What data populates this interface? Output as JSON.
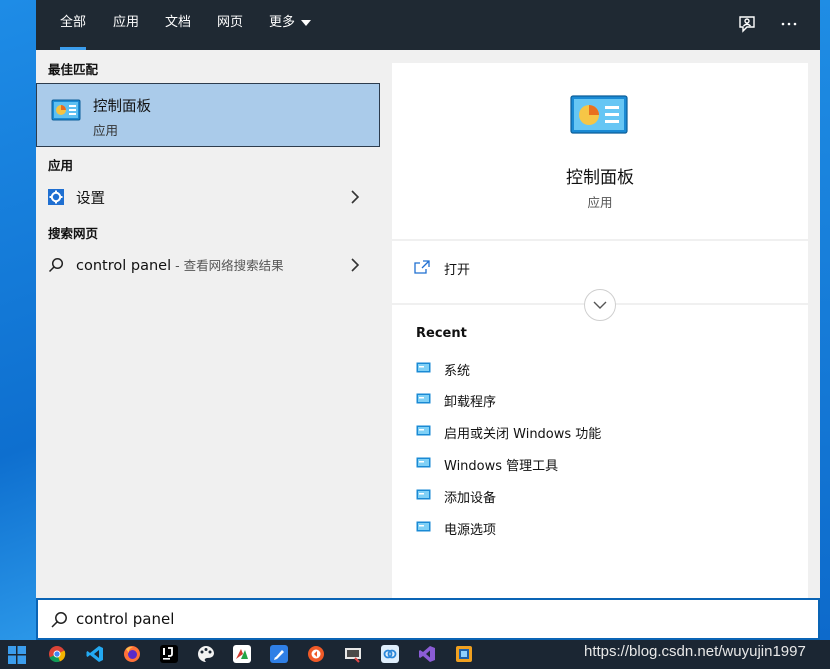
{
  "tabs": [
    {
      "label": "全部",
      "active": true
    },
    {
      "label": "应用"
    },
    {
      "label": "文档"
    },
    {
      "label": "网页"
    },
    {
      "label": "更多"
    }
  ],
  "topbar_icons": [
    "feedback-icon",
    "more-options-icon"
  ],
  "left": {
    "best_match_title": "最佳匹配",
    "best_match": {
      "title": "控制面板",
      "subtitle": "应用",
      "icon": "control-panel-icon"
    },
    "apps_title": "应用",
    "apps": [
      {
        "label": "设置",
        "icon": "gear-icon"
      }
    ],
    "web_title": "搜索网页",
    "web": [
      {
        "label": "control panel",
        "hint": " - 查看网络搜索结果",
        "icon": "search-icon"
      }
    ]
  },
  "right": {
    "title": "控制面板",
    "subtitle": "应用",
    "open_label": "打开",
    "recent_title": "Recent",
    "recent": [
      "系统",
      "卸载程序",
      "启用或关闭 Windows 功能",
      "Windows 管理工具",
      "添加设备",
      "电源选项"
    ]
  },
  "search": {
    "value": "control panel"
  },
  "taskbar": {
    "apps": [
      "chrome-icon",
      "vscode-icon",
      "firefox-icon",
      "intellij-icon",
      "paint-icon",
      "app-icon",
      "feishu-icon",
      "app-icon-2",
      "snip-icon",
      "app-icon-3",
      "visual-studio-icon",
      "app-icon-4"
    ]
  },
  "watermark": "https://blog.csdn.net/wuyujin1997",
  "colors": {
    "accent": "#3b9ded",
    "selected": "#aacbea",
    "topbar": "#1f2933",
    "taskbar": "#1b2633"
  }
}
